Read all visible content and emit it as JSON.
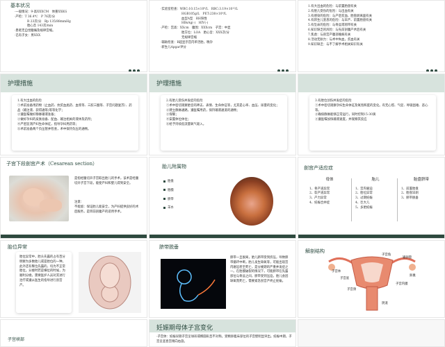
{
  "slides": {
    "s1": {
      "title": "基本状况",
      "lines": [
        "·一般情况：9-高XXXCM　体重XXKG",
        "·产检：T 36.4℃　P 76次/分",
        "R 23次/分　Bp 135/88mmHg",
        "胎心音 143次/min",
        "·患者无自觉腹痛及规律宫缩。",
        "",
        "·已有子女：男XXX"
      ]
    },
    "s2": {
      "lines": [
        "·实验室检查：WBC:10.15×10⁹/L　RBC:3.19×10¹²/L",
        "HGB105g/L　PET:238×10⁹/L",
        "血型A型　RH阳性",
        "HBsAg(-)　HIV(-)",
        "·产检：宫高：XXcm　腹围：XXXcm　子宫：中显",
        "胎方位：LOA　胎心音：XXX次/分",
        "无规律宫缩",
        "·辅助检查：B超显示宫内单活胎，晚孕",
        "·新生儿Apgar评分"
      ]
    },
    "s3": {
      "lines": [
        "1.有大出血的危险：与前置胎盘有关",
        "2.有胎儿受伤的危险：与出血有关",
        "3.有感染的危险：与产后贫血、胎盘剥离面有关",
        "4.有新生儿窒息的危险：与早产、前置胎盘有关",
        "5.有坠床的危险：与骨盆或韧带有关",
        "6.知识缺乏的风险：与先前剖腹产术后有关",
        "7.焦虑：与剖宫产腹部瘢痕有关",
        "8.活动无耐力：与术中失血，贫血有关",
        "9.知识缺乏：与不了解手术相关知识有关"
      ]
    },
    "s4": {
      "title": "护理措施",
      "card": "1.有大出血的危险\n①术前准备用药物（止血药、抗贫血类药、血浆等、三胶三酸等、子宫问题复苏）、药品（输注液、获得通等)等等化学；\n②遵医嘱做好静脉输液准备；\n③做好孕妇的皮肤准备、配血、输注相关的液体及药剂；\n④严密监测产妇生命体征，指导孕妇用药等；\n⑤术前准备两个负压管并检查，术中保持负压的通畅。"
    },
    "s5": {
      "title": "护理措施",
      "card": "2.有胎儿受伤并发症的危险\n①术中密切观察胎音的神志、表情、生命体征等，尤其是心率、血压、尿量的变化；\n②建立静脉通路，遵医嘱用药，保持输液通道的通畅；\n③保暖；\n④安置体位体位；\n⑤给予持续低流量氧气吸入。"
    },
    "s6": {
      "title": "",
      "card": "3.有胎位创伤并发症的危险\n①术中密切观察孕妇生命体征及氧饱和度的变化。有无心慌、气促、呼吸困难、恶心等。\n②确保静脉能够正常运行，同时控制15-30滴\n③遵医嘱加快输液速度，并观察其反应"
    },
    "s7": {
      "title": "子宫下段剖宫产术（Cesarean section）",
      "desc": "是指经腹切开子宫取出胎儿的手术，该术是经腹切开子宫下段，能使产妇和婴儿得到安全。",
      "note": "注意：\n不能留：保证胎儿能安全，为产妇提供良好的术后服务，是目前剖腹产的适用手术。"
    },
    "s8": {
      "title": "胎儿附属物",
      "items": [
        "胎盘",
        "胎膜",
        "脐带",
        "羊水"
      ]
    },
    "s9": {
      "title": "剖宫产适应症",
      "cols": [
        {
          "head": "母体",
          "items": [
            "1、骨产道异常",
            "2、软产道异常",
            "3、产力异常",
            "4、妊娠合并症"
          ]
        },
        {
          "head": "胎儿",
          "items": [
            "1、宫内窘迫",
            "2、胎位异常",
            "3、过期妊娠",
            "4、巨大儿",
            "5、多胎妊娠"
          ]
        },
        {
          "head": "胎盘脐带",
          "items": [
            "1、前置胎盘",
            "2、胎盘早剥",
            "3、脐带脱垂"
          ]
        }
      ]
    },
    "s10": {
      "title": "胎位异常",
      "card": "胎位异常中，胎头先露的占有百分明察为多数胎儿或是胎位的一种，此外还有臀位先露的，均为不正常胎位。分娩时若是横位的时候，为顺利分娩，需要医护人员对其进行治疗或遵从医生的指导进行剖宫产。"
    },
    "s11": {
      "title": "脐带脱垂",
      "text": "脐带一旦脱离，胎儿脐带受到挤压，导致脐带循环中断，胎儿发生缺氧等，可能出现宫内窘迫甚至死亡，是分娩期的严重并发症之一。在胎膜破裂的情况下，可能脐带在先露部位与骨盆之间，脐带受到压迫，胎儿会因缺氧而死亡，需要紧急剖宫产终止妊娠。"
    },
    "s12": {
      "title": "解剖结构",
      "labels": [
        "输卵管",
        "子宫体",
        "子宫底",
        "卵巢",
        "子宫颈",
        "阴道",
        "子宫内膜",
        "子宫角"
      ]
    },
    "s13": {
      "title": "子宫峡部"
    },
    "s14": {
      "title": "妊娠期母体子宫变化",
      "text": "·子宫体：妊娠早期子宫呈球形或椭圆形且不对称。受精卵着床部位的子宫壁明显突出。妊娠中期，子宫呈竖直宫稍向右旋。"
    }
  },
  "colors": {
    "accent": "#2e4a3f",
    "header": "#d7e3dd"
  }
}
